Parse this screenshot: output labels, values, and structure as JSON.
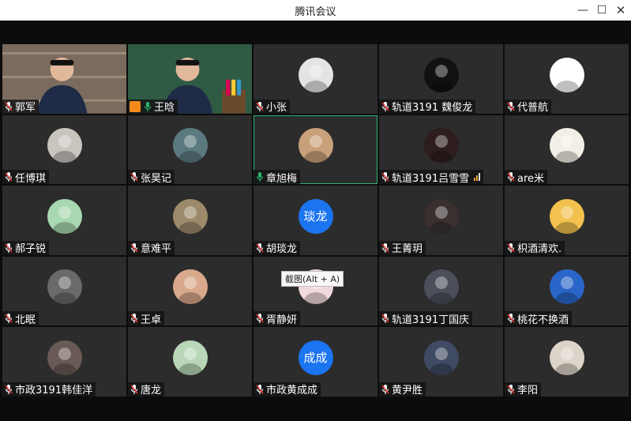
{
  "window": {
    "title": "腾讯会议",
    "minimize": "—",
    "maximize": "☐",
    "close": "✕"
  },
  "tooltip": "截图(Alt + A)",
  "participants": [
    {
      "name": "郭军",
      "mic": "muted",
      "type": "video",
      "bg": "#7a6b5e"
    },
    {
      "name": "王晗",
      "mic": "on",
      "type": "video",
      "bg": "#2f5a44",
      "badge": "share"
    },
    {
      "name": "小张",
      "mic": "muted",
      "type": "avatar",
      "avatar_color": "#e4e4e4",
      "avatar_icon": "cat-avatar-icon"
    },
    {
      "name": "轨道3191 魏俊龙",
      "mic": "muted",
      "type": "avatar",
      "avatar_color": "#111111",
      "avatar_icon": "bird-avatar-icon"
    },
    {
      "name": "代普航",
      "mic": "muted",
      "type": "avatar",
      "avatar_color": "#ffffff",
      "avatar_icon": "sketch-avatar-icon"
    },
    {
      "name": "任博琪",
      "mic": "muted",
      "type": "avatar",
      "avatar_color": "#c9c4be",
      "avatar_icon": "person-avatar-icon"
    },
    {
      "name": "张昊记",
      "mic": "muted",
      "type": "avatar",
      "avatar_color": "#5b7a80",
      "avatar_icon": "landscape-avatar-icon"
    },
    {
      "name": "章旭梅",
      "mic": "on",
      "type": "avatar",
      "avatar_color": "#c8a07a",
      "avatar_icon": "glasses-avatar-icon",
      "active": true
    },
    {
      "name": "轨道3191吕雪雪",
      "mic": "muted",
      "type": "avatar",
      "avatar_color": "#2d1d1d",
      "avatar_icon": "girl-avatar-icon",
      "signal": true
    },
    {
      "name": "are米",
      "mic": "muted",
      "type": "avatar",
      "avatar_color": "#f4efe6",
      "avatar_icon": "calligraphy-avatar-icon"
    },
    {
      "name": "郝子锐",
      "mic": "muted",
      "type": "avatar",
      "avatar_color": "#a8d8b0",
      "avatar_icon": "cartoon-avatar-icon"
    },
    {
      "name": "意难平",
      "mic": "muted",
      "type": "avatar",
      "avatar_color": "#9c8a6a",
      "avatar_icon": "anime-avatar-icon"
    },
    {
      "name": "胡琰龙",
      "mic": "muted",
      "type": "text",
      "avatar_text": "琰龙"
    },
    {
      "name": "王菁玥",
      "mic": "muted",
      "type": "avatar",
      "avatar_color": "#3a3030",
      "avatar_icon": "girl-avatar-icon"
    },
    {
      "name": "枳酒清欢.",
      "mic": "muted",
      "type": "avatar",
      "avatar_color": "#f2c14e",
      "avatar_icon": "tiger-avatar-icon"
    },
    {
      "name": "北眠",
      "mic": "muted",
      "type": "avatar",
      "avatar_color": "#6a6a6a",
      "avatar_icon": "person-avatar-icon"
    },
    {
      "name": "王卓",
      "mic": "muted",
      "type": "avatar",
      "avatar_color": "#d9a98c",
      "avatar_icon": "anime-avatar-icon"
    },
    {
      "name": "胥静妍",
      "mic": "muted",
      "type": "avatar",
      "avatar_color": "#f2d9dd",
      "avatar_icon": "pink-avatar-icon"
    },
    {
      "name": "轨道3191丁国庆",
      "mic": "muted",
      "type": "avatar",
      "avatar_color": "#4a4f5a",
      "avatar_icon": "person-avatar-icon"
    },
    {
      "name": "桃花不换酒",
      "mic": "muted",
      "type": "avatar",
      "avatar_color": "#2a66c9",
      "avatar_icon": "blue-avatar-icon"
    },
    {
      "name": "市政3191韩佳洋",
      "mic": "muted",
      "type": "avatar",
      "avatar_color": "#6a5a55",
      "avatar_icon": "face-avatar-icon"
    },
    {
      "name": "唐龙",
      "mic": "muted",
      "type": "avatar",
      "avatar_color": "#b9d7b8",
      "avatar_icon": "anime-avatar-icon"
    },
    {
      "name": "市政黄成成",
      "mic": "muted",
      "type": "text",
      "avatar_text": "成成"
    },
    {
      "name": "黄尹胜",
      "mic": "muted",
      "type": "avatar",
      "avatar_color": "#3f4a63",
      "avatar_icon": "anime-avatar-icon"
    },
    {
      "name": "李阳",
      "mic": "muted",
      "type": "avatar",
      "avatar_color": "#dcd3c9",
      "avatar_icon": "dog-avatar-icon"
    }
  ]
}
